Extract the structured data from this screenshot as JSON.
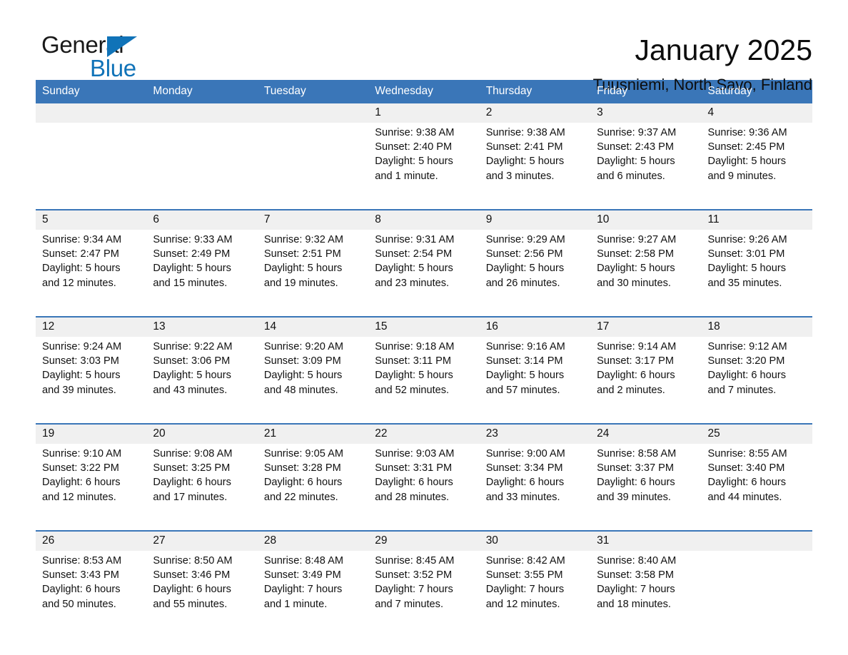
{
  "brand": {
    "name_part1": "General",
    "name_part2": "Blue",
    "accent_color": "#1073b8"
  },
  "header": {
    "title": "January 2025",
    "subtitle": "Tuusniemi, North Savo, Finland"
  },
  "theme": {
    "header_row_bg": "#3a76b8",
    "day_strip_bg": "#f0f0f0",
    "separator_color": "#3a76b8",
    "page_bg": "#ffffff",
    "text_color": "#111111"
  },
  "weekday_headers": [
    "Sunday",
    "Monday",
    "Tuesday",
    "Wednesday",
    "Thursday",
    "Friday",
    "Saturday"
  ],
  "weeks": [
    {
      "days": [
        {
          "number": "",
          "empty": true,
          "sunrise": "",
          "sunset": "",
          "daylight_line1": "",
          "daylight_line2": ""
        },
        {
          "number": "",
          "empty": true,
          "sunrise": "",
          "sunset": "",
          "daylight_line1": "",
          "daylight_line2": ""
        },
        {
          "number": "",
          "empty": true,
          "sunrise": "",
          "sunset": "",
          "daylight_line1": "",
          "daylight_line2": ""
        },
        {
          "number": "1",
          "empty": false,
          "sunrise": "Sunrise: 9:38 AM",
          "sunset": "Sunset: 2:40 PM",
          "daylight_line1": "Daylight: 5 hours",
          "daylight_line2": "and 1 minute."
        },
        {
          "number": "2",
          "empty": false,
          "sunrise": "Sunrise: 9:38 AM",
          "sunset": "Sunset: 2:41 PM",
          "daylight_line1": "Daylight: 5 hours",
          "daylight_line2": "and 3 minutes."
        },
        {
          "number": "3",
          "empty": false,
          "sunrise": "Sunrise: 9:37 AM",
          "sunset": "Sunset: 2:43 PM",
          "daylight_line1": "Daylight: 5 hours",
          "daylight_line2": "and 6 minutes."
        },
        {
          "number": "4",
          "empty": false,
          "sunrise": "Sunrise: 9:36 AM",
          "sunset": "Sunset: 2:45 PM",
          "daylight_line1": "Daylight: 5 hours",
          "daylight_line2": "and 9 minutes."
        }
      ]
    },
    {
      "days": [
        {
          "number": "5",
          "empty": false,
          "sunrise": "Sunrise: 9:34 AM",
          "sunset": "Sunset: 2:47 PM",
          "daylight_line1": "Daylight: 5 hours",
          "daylight_line2": "and 12 minutes."
        },
        {
          "number": "6",
          "empty": false,
          "sunrise": "Sunrise: 9:33 AM",
          "sunset": "Sunset: 2:49 PM",
          "daylight_line1": "Daylight: 5 hours",
          "daylight_line2": "and 15 minutes."
        },
        {
          "number": "7",
          "empty": false,
          "sunrise": "Sunrise: 9:32 AM",
          "sunset": "Sunset: 2:51 PM",
          "daylight_line1": "Daylight: 5 hours",
          "daylight_line2": "and 19 minutes."
        },
        {
          "number": "8",
          "empty": false,
          "sunrise": "Sunrise: 9:31 AM",
          "sunset": "Sunset: 2:54 PM",
          "daylight_line1": "Daylight: 5 hours",
          "daylight_line2": "and 23 minutes."
        },
        {
          "number": "9",
          "empty": false,
          "sunrise": "Sunrise: 9:29 AM",
          "sunset": "Sunset: 2:56 PM",
          "daylight_line1": "Daylight: 5 hours",
          "daylight_line2": "and 26 minutes."
        },
        {
          "number": "10",
          "empty": false,
          "sunrise": "Sunrise: 9:27 AM",
          "sunset": "Sunset: 2:58 PM",
          "daylight_line1": "Daylight: 5 hours",
          "daylight_line2": "and 30 minutes."
        },
        {
          "number": "11",
          "empty": false,
          "sunrise": "Sunrise: 9:26 AM",
          "sunset": "Sunset: 3:01 PM",
          "daylight_line1": "Daylight: 5 hours",
          "daylight_line2": "and 35 minutes."
        }
      ]
    },
    {
      "days": [
        {
          "number": "12",
          "empty": false,
          "sunrise": "Sunrise: 9:24 AM",
          "sunset": "Sunset: 3:03 PM",
          "daylight_line1": "Daylight: 5 hours",
          "daylight_line2": "and 39 minutes."
        },
        {
          "number": "13",
          "empty": false,
          "sunrise": "Sunrise: 9:22 AM",
          "sunset": "Sunset: 3:06 PM",
          "daylight_line1": "Daylight: 5 hours",
          "daylight_line2": "and 43 minutes."
        },
        {
          "number": "14",
          "empty": false,
          "sunrise": "Sunrise: 9:20 AM",
          "sunset": "Sunset: 3:09 PM",
          "daylight_line1": "Daylight: 5 hours",
          "daylight_line2": "and 48 minutes."
        },
        {
          "number": "15",
          "empty": false,
          "sunrise": "Sunrise: 9:18 AM",
          "sunset": "Sunset: 3:11 PM",
          "daylight_line1": "Daylight: 5 hours",
          "daylight_line2": "and 52 minutes."
        },
        {
          "number": "16",
          "empty": false,
          "sunrise": "Sunrise: 9:16 AM",
          "sunset": "Sunset: 3:14 PM",
          "daylight_line1": "Daylight: 5 hours",
          "daylight_line2": "and 57 minutes."
        },
        {
          "number": "17",
          "empty": false,
          "sunrise": "Sunrise: 9:14 AM",
          "sunset": "Sunset: 3:17 PM",
          "daylight_line1": "Daylight: 6 hours",
          "daylight_line2": "and 2 minutes."
        },
        {
          "number": "18",
          "empty": false,
          "sunrise": "Sunrise: 9:12 AM",
          "sunset": "Sunset: 3:20 PM",
          "daylight_line1": "Daylight: 6 hours",
          "daylight_line2": "and 7 minutes."
        }
      ]
    },
    {
      "days": [
        {
          "number": "19",
          "empty": false,
          "sunrise": "Sunrise: 9:10 AM",
          "sunset": "Sunset: 3:22 PM",
          "daylight_line1": "Daylight: 6 hours",
          "daylight_line2": "and 12 minutes."
        },
        {
          "number": "20",
          "empty": false,
          "sunrise": "Sunrise: 9:08 AM",
          "sunset": "Sunset: 3:25 PM",
          "daylight_line1": "Daylight: 6 hours",
          "daylight_line2": "and 17 minutes."
        },
        {
          "number": "21",
          "empty": false,
          "sunrise": "Sunrise: 9:05 AM",
          "sunset": "Sunset: 3:28 PM",
          "daylight_line1": "Daylight: 6 hours",
          "daylight_line2": "and 22 minutes."
        },
        {
          "number": "22",
          "empty": false,
          "sunrise": "Sunrise: 9:03 AM",
          "sunset": "Sunset: 3:31 PM",
          "daylight_line1": "Daylight: 6 hours",
          "daylight_line2": "and 28 minutes."
        },
        {
          "number": "23",
          "empty": false,
          "sunrise": "Sunrise: 9:00 AM",
          "sunset": "Sunset: 3:34 PM",
          "daylight_line1": "Daylight: 6 hours",
          "daylight_line2": "and 33 minutes."
        },
        {
          "number": "24",
          "empty": false,
          "sunrise": "Sunrise: 8:58 AM",
          "sunset": "Sunset: 3:37 PM",
          "daylight_line1": "Daylight: 6 hours",
          "daylight_line2": "and 39 minutes."
        },
        {
          "number": "25",
          "empty": false,
          "sunrise": "Sunrise: 8:55 AM",
          "sunset": "Sunset: 3:40 PM",
          "daylight_line1": "Daylight: 6 hours",
          "daylight_line2": "and 44 minutes."
        }
      ]
    },
    {
      "days": [
        {
          "number": "26",
          "empty": false,
          "sunrise": "Sunrise: 8:53 AM",
          "sunset": "Sunset: 3:43 PM",
          "daylight_line1": "Daylight: 6 hours",
          "daylight_line2": "and 50 minutes."
        },
        {
          "number": "27",
          "empty": false,
          "sunrise": "Sunrise: 8:50 AM",
          "sunset": "Sunset: 3:46 PM",
          "daylight_line1": "Daylight: 6 hours",
          "daylight_line2": "and 55 minutes."
        },
        {
          "number": "28",
          "empty": false,
          "sunrise": "Sunrise: 8:48 AM",
          "sunset": "Sunset: 3:49 PM",
          "daylight_line1": "Daylight: 7 hours",
          "daylight_line2": "and 1 minute."
        },
        {
          "number": "29",
          "empty": false,
          "sunrise": "Sunrise: 8:45 AM",
          "sunset": "Sunset: 3:52 PM",
          "daylight_line1": "Daylight: 7 hours",
          "daylight_line2": "and 7 minutes."
        },
        {
          "number": "30",
          "empty": false,
          "sunrise": "Sunrise: 8:42 AM",
          "sunset": "Sunset: 3:55 PM",
          "daylight_line1": "Daylight: 7 hours",
          "daylight_line2": "and 12 minutes."
        },
        {
          "number": "31",
          "empty": false,
          "sunrise": "Sunrise: 8:40 AM",
          "sunset": "Sunset: 3:58 PM",
          "daylight_line1": "Daylight: 7 hours",
          "daylight_line2": "and 18 minutes."
        },
        {
          "number": "",
          "empty": true,
          "sunrise": "",
          "sunset": "",
          "daylight_line1": "",
          "daylight_line2": ""
        }
      ]
    }
  ]
}
